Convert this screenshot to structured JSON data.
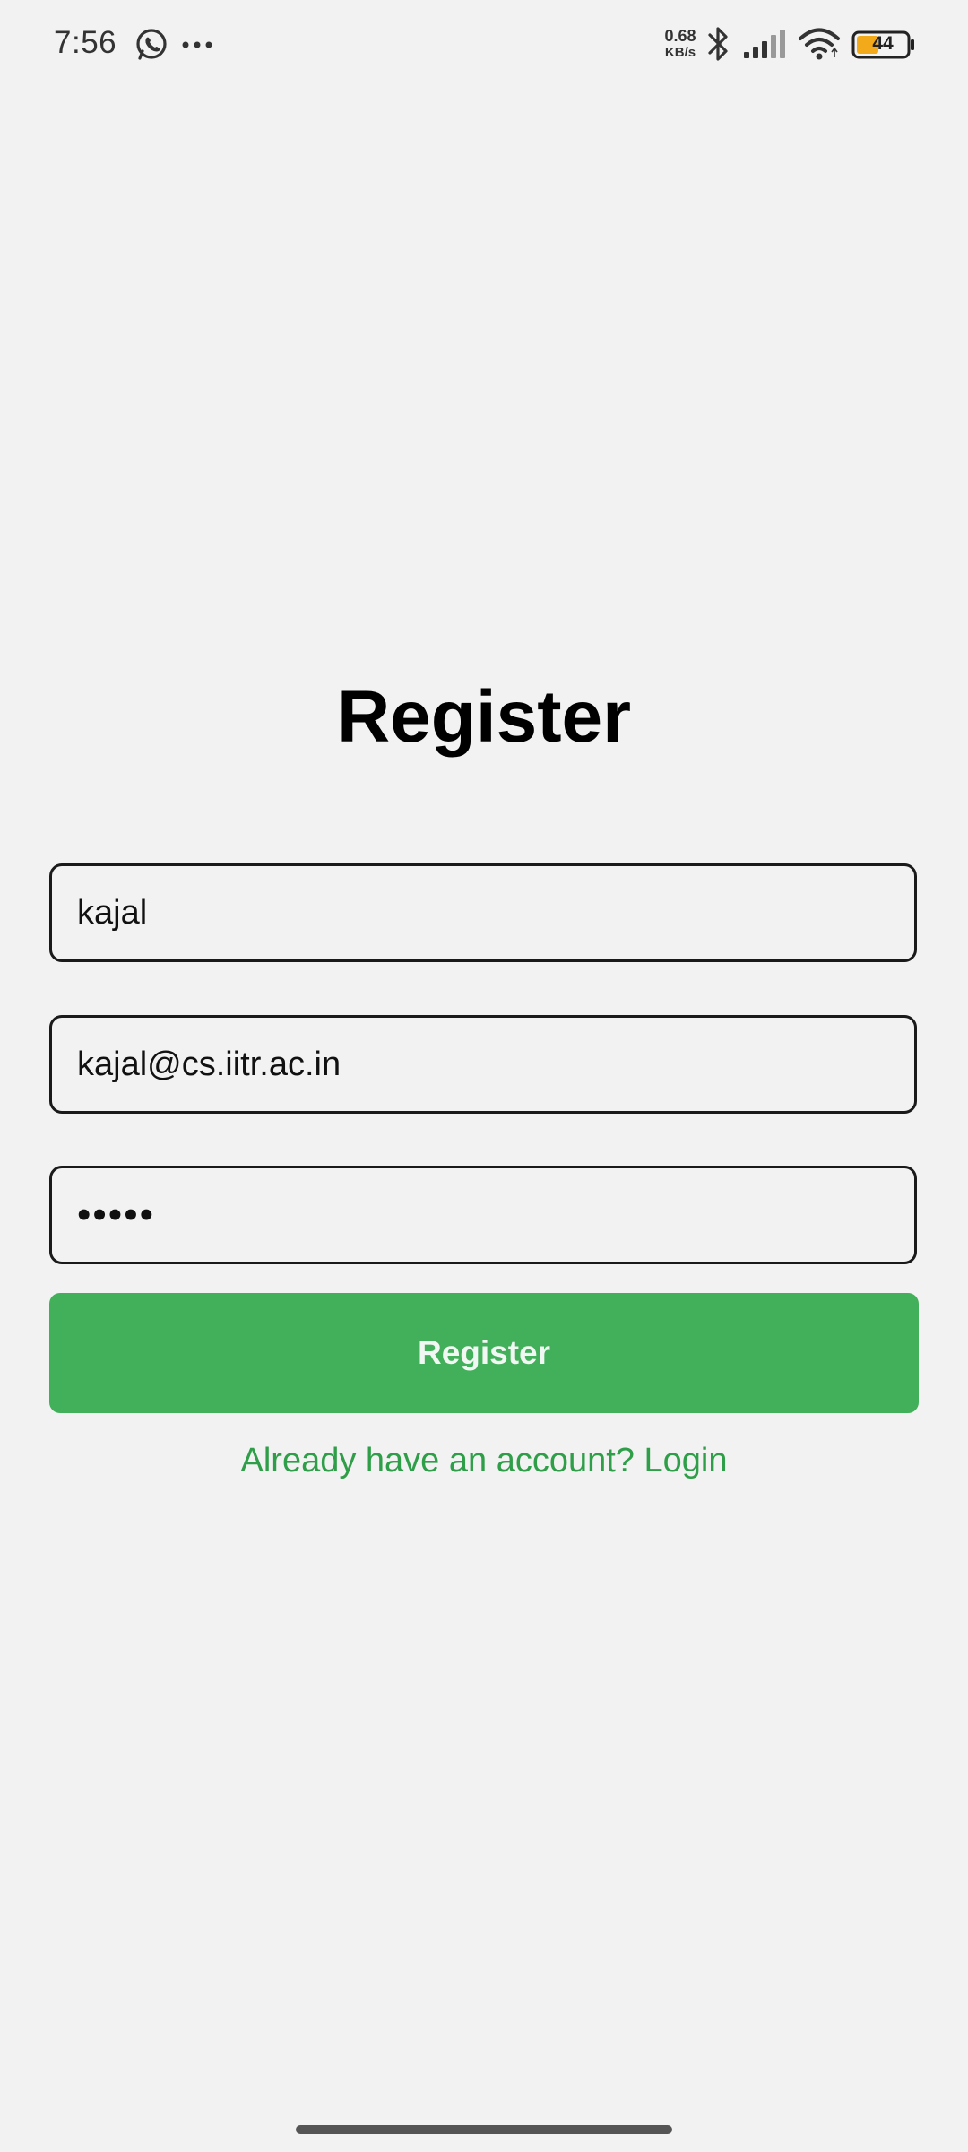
{
  "status_bar": {
    "time": "7:56",
    "net_speed_value": "0.68",
    "net_speed_unit": "KB/s",
    "battery_level": "44",
    "icons": [
      "whatsapp-icon",
      "more-dots-icon",
      "bluetooth-icon",
      "signal-icon",
      "wifi-icon",
      "battery-icon"
    ]
  },
  "form": {
    "title": "Register",
    "name_value": "kajal",
    "email_value": "kajal@cs.iitr.ac.in",
    "password_value": "kajal",
    "register_button_label": "Register",
    "login_link": "Already have an account? Login"
  },
  "colors": {
    "background": "#f2f2f2",
    "primary_green": "#42b05a",
    "link_green": "#2f9e48",
    "battery_fill": "#f2a91a"
  }
}
